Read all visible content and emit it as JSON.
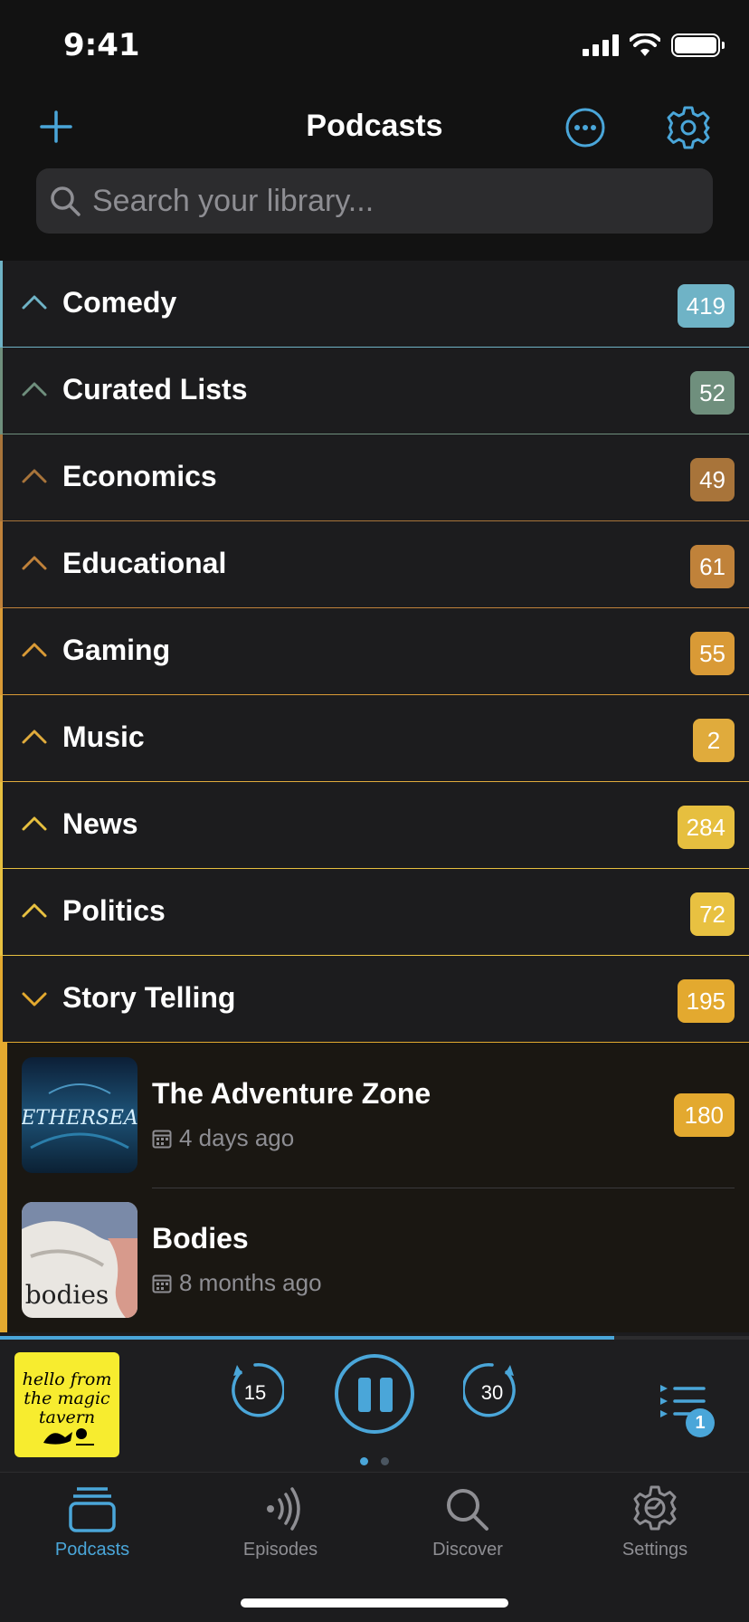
{
  "status": {
    "time": "9:41"
  },
  "nav": {
    "title": "Podcasts"
  },
  "search": {
    "placeholder": "Search your library..."
  },
  "categories": [
    {
      "label": "Comedy",
      "count": "419",
      "color": "#6fb3c6",
      "expanded": false
    },
    {
      "label": "Curated Lists",
      "count": "52",
      "color": "#6f8f7d",
      "expanded": false
    },
    {
      "label": "Economics",
      "count": "49",
      "color": "#a8743a",
      "expanded": false
    },
    {
      "label": "Educational",
      "count": "61",
      "color": "#c0823a",
      "expanded": false
    },
    {
      "label": "Gaming",
      "count": "55",
      "color": "#d99a36",
      "expanded": false
    },
    {
      "label": "Music",
      "count": "2",
      "color": "#e0ab3c",
      "expanded": false
    },
    {
      "label": "News",
      "count": "284",
      "color": "#e6bf3f",
      "expanded": false
    },
    {
      "label": "Politics",
      "count": "72",
      "color": "#e8c141",
      "expanded": false
    },
    {
      "label": "Story Telling",
      "count": "195",
      "color": "#e3a92f",
      "expanded": true
    }
  ],
  "podcasts": [
    {
      "title": "The Adventure Zone",
      "date": "4 days ago",
      "count": "180",
      "art_text": "ETHERSEA"
    },
    {
      "title": "Bodies",
      "date": "8 months ago",
      "count": "",
      "art_text": "bodies"
    }
  ],
  "player": {
    "art_text": "hello from the magic tavern",
    "skip_back": "15",
    "skip_forward": "30",
    "queue_count": "1",
    "progress": 0.82,
    "page_dots": 2,
    "active_dot": 0
  },
  "tabs": [
    {
      "label": "Podcasts",
      "active": true,
      "icon": "podcasts-icon"
    },
    {
      "label": "Episodes",
      "active": false,
      "icon": "episodes-icon"
    },
    {
      "label": "Discover",
      "active": false,
      "icon": "discover-icon"
    },
    {
      "label": "Settings",
      "active": false,
      "icon": "settings-icon"
    }
  ],
  "colors": {
    "accent": "#4aa6d9",
    "inactive_tab": "#8e8e93",
    "background": "#1c1c1e"
  }
}
